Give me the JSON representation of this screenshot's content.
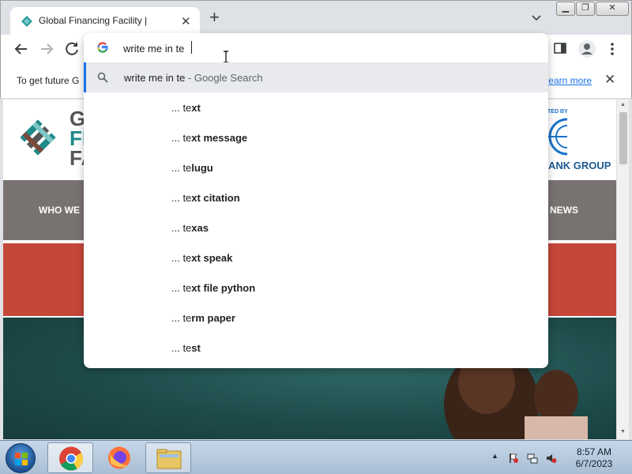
{
  "browser": {
    "tab": {
      "title": "Global Financing Facility |"
    },
    "omnibox": {
      "input_value": "write me in te",
      "selected": {
        "text": "write me in te",
        "suffix": " - Google Search"
      },
      "suggestions": [
        {
          "prefix": "... te",
          "bold": "xt"
        },
        {
          "prefix": "... te",
          "mid": "xt me",
          "bold": "ssage"
        },
        {
          "prefix": "... te",
          "bold": "lugu"
        },
        {
          "prefix": "... te",
          "bold": "xt citation"
        },
        {
          "prefix": "... te",
          "bold": "xas"
        },
        {
          "prefix": "... te",
          "bold": "xt speak"
        },
        {
          "prefix": "... te",
          "bold": "xt file python"
        },
        {
          "prefix": "... te",
          "bold": "rm paper"
        },
        {
          "prefix": "... te",
          "bold": "st"
        }
      ]
    },
    "infobar": {
      "text": "To get future G",
      "link": "earn more"
    }
  },
  "webpage": {
    "logo": {
      "line1": "G",
      "line2": "FI",
      "line3": "FA"
    },
    "worldbank": {
      "small": "TED BY",
      "name": "ANK GROUP"
    },
    "nav": {
      "left": "WHO WE",
      "right": "NEWS"
    }
  },
  "taskbar": {
    "time": "8:57 AM",
    "date": "6/7/2023"
  },
  "colors": {
    "accent": "#1a73e8",
    "nav_grey": "#787371",
    "red_band": "#c5473a",
    "hero_teal": "#1d4b4a"
  }
}
